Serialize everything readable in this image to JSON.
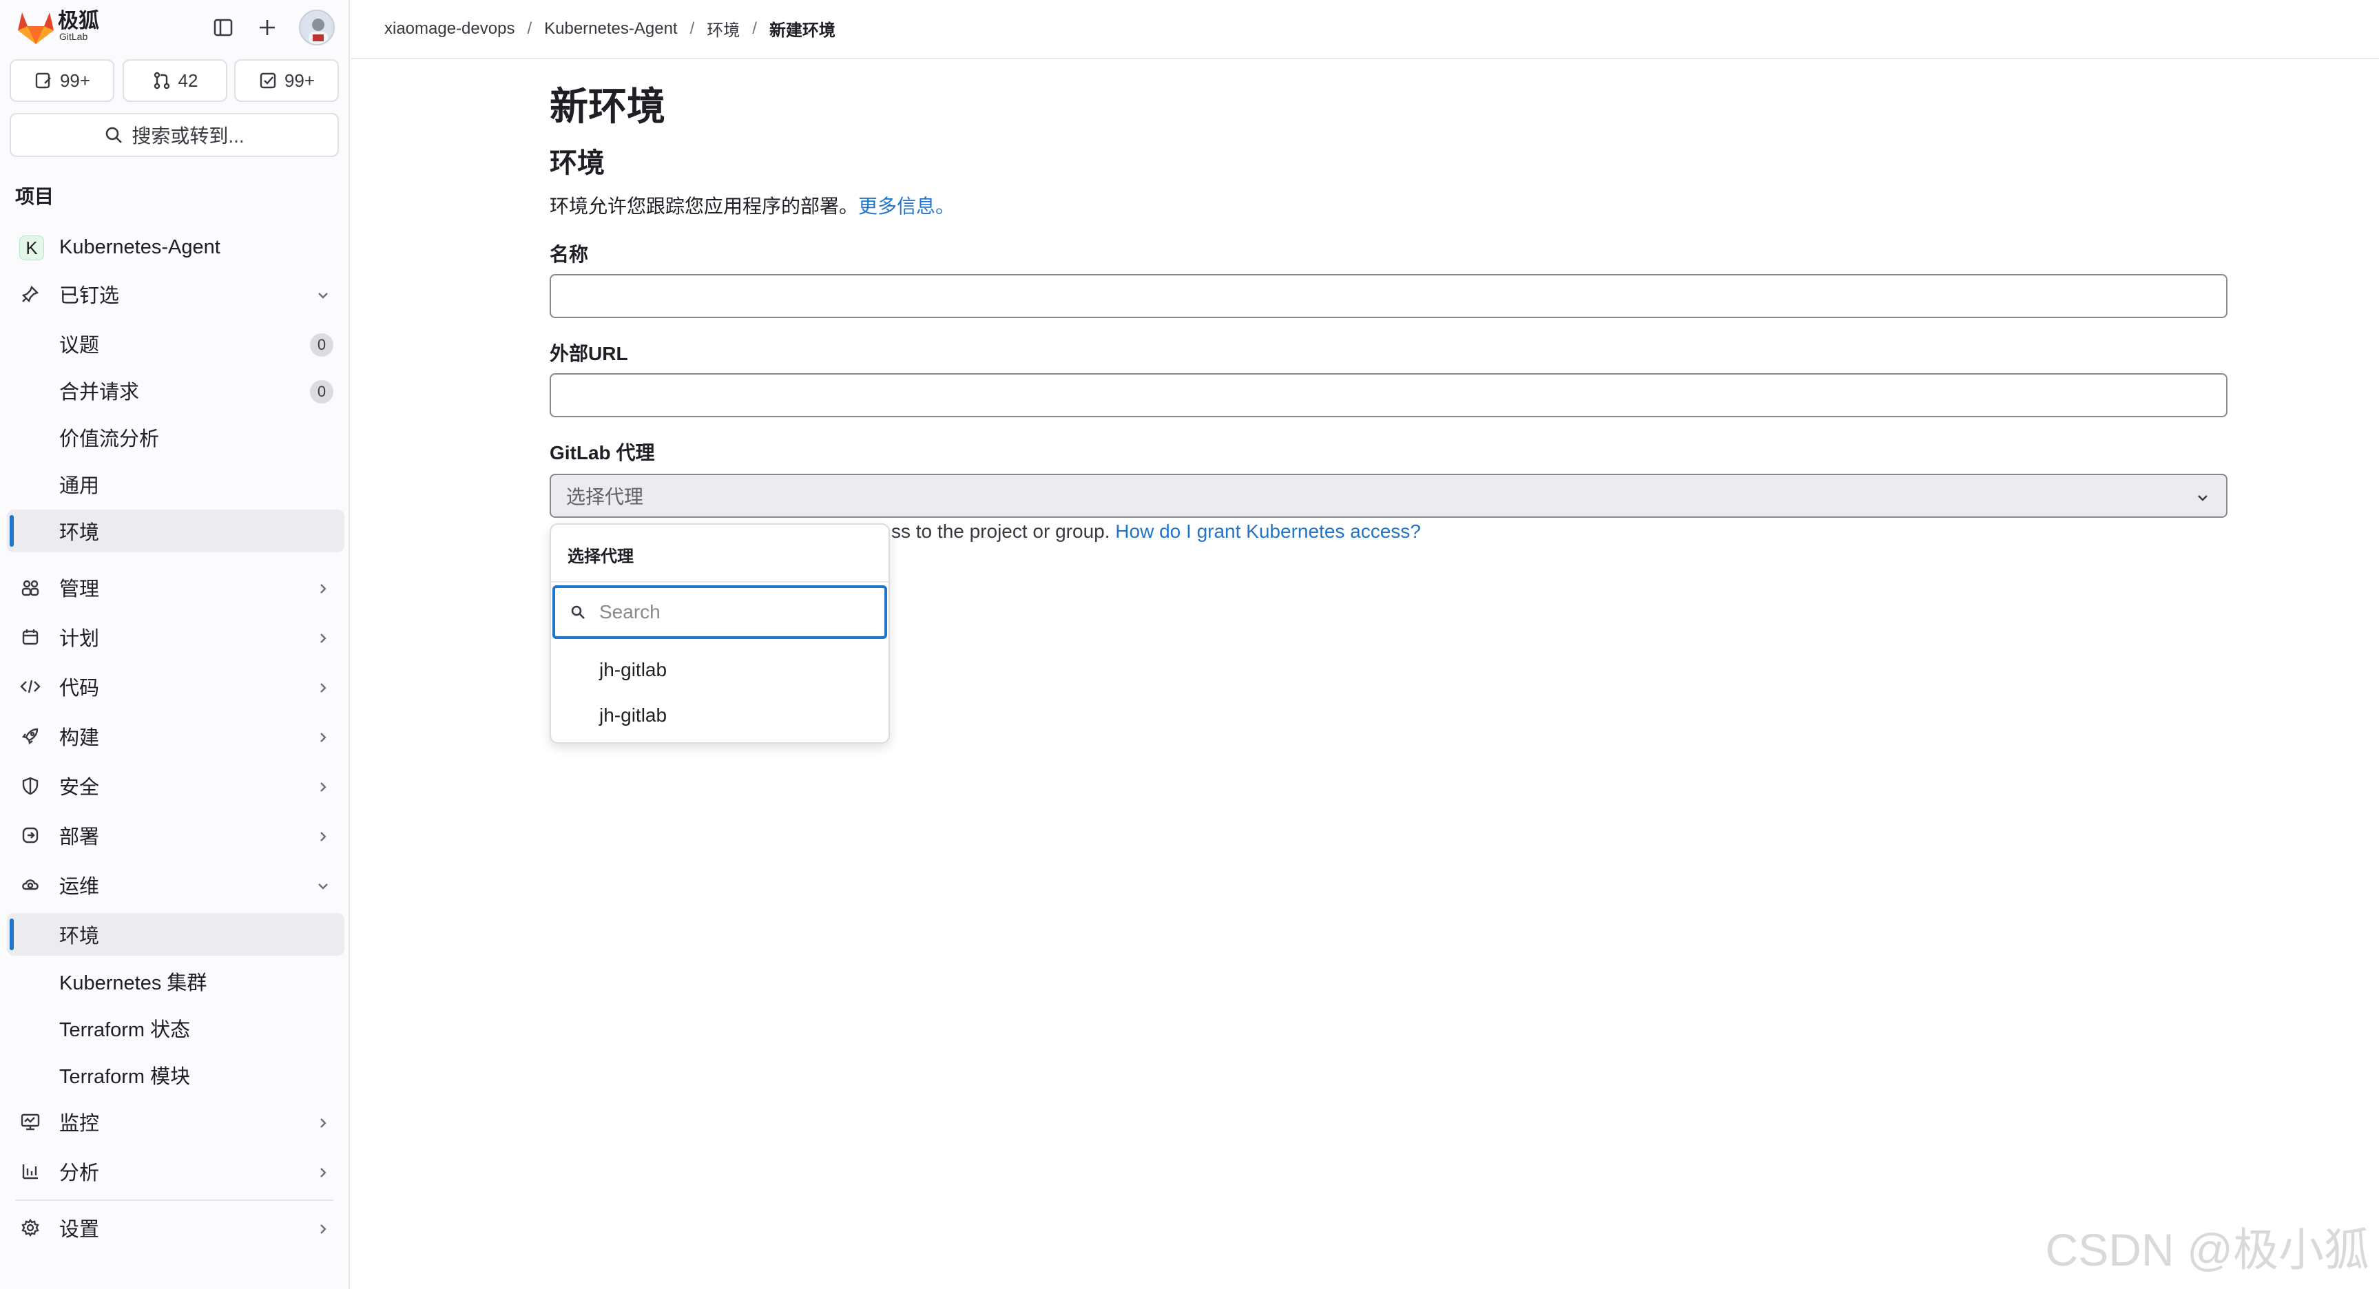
{
  "brand": {
    "name": "极狐",
    "sub": "GitLab"
  },
  "counters": {
    "issues": "99+",
    "merge_requests": "42",
    "todos": "99+"
  },
  "search": {
    "label": "搜索或转到..."
  },
  "sidebar": {
    "section_title": "项目",
    "project_initial": "K",
    "project_name": "Kubernetes-Agent",
    "pinned": {
      "label": "已钉选",
      "items": [
        {
          "label": "议题",
          "badge": "0"
        },
        {
          "label": "合并请求",
          "badge": "0"
        },
        {
          "label": "价值流分析"
        },
        {
          "label": "通用"
        },
        {
          "label": "环境"
        }
      ]
    },
    "groups": [
      {
        "label": "管理"
      },
      {
        "label": "计划"
      },
      {
        "label": "代码"
      },
      {
        "label": "构建"
      },
      {
        "label": "安全"
      },
      {
        "label": "部署"
      }
    ],
    "operate": {
      "label": "运维",
      "items": [
        {
          "label": "环境"
        },
        {
          "label": "Kubernetes 集群"
        },
        {
          "label": "Terraform 状态"
        },
        {
          "label": "Terraform 模块"
        }
      ]
    },
    "monitor": {
      "label": "监控"
    },
    "analyze": {
      "label": "分析"
    },
    "settings": {
      "label": "设置"
    }
  },
  "breadcrumb": [
    "xiaomage-devops",
    "Kubernetes-Agent",
    "环境",
    "新建环境"
  ],
  "page": {
    "title": "新环境",
    "section": "环境",
    "description": "环境允许您跟踪您应用程序的部署。",
    "more_info": "更多信息。",
    "name_label": "名称",
    "url_label": "外部URL",
    "agent_label": "GitLab 代理",
    "agent_placeholder": "选择代理",
    "help_text": "ss to the project or group.",
    "help_link": "How do I grant Kubernetes access?"
  },
  "dropdown": {
    "title": "选择代理",
    "search_placeholder": "Search",
    "items": [
      "jh-gitlab",
      "jh-gitlab"
    ]
  },
  "watermark": "CSDN @极小狐",
  "colors": {
    "link": "#1f75cb",
    "active_bar": "#1f75cb",
    "brand_orange": "#e24329"
  }
}
